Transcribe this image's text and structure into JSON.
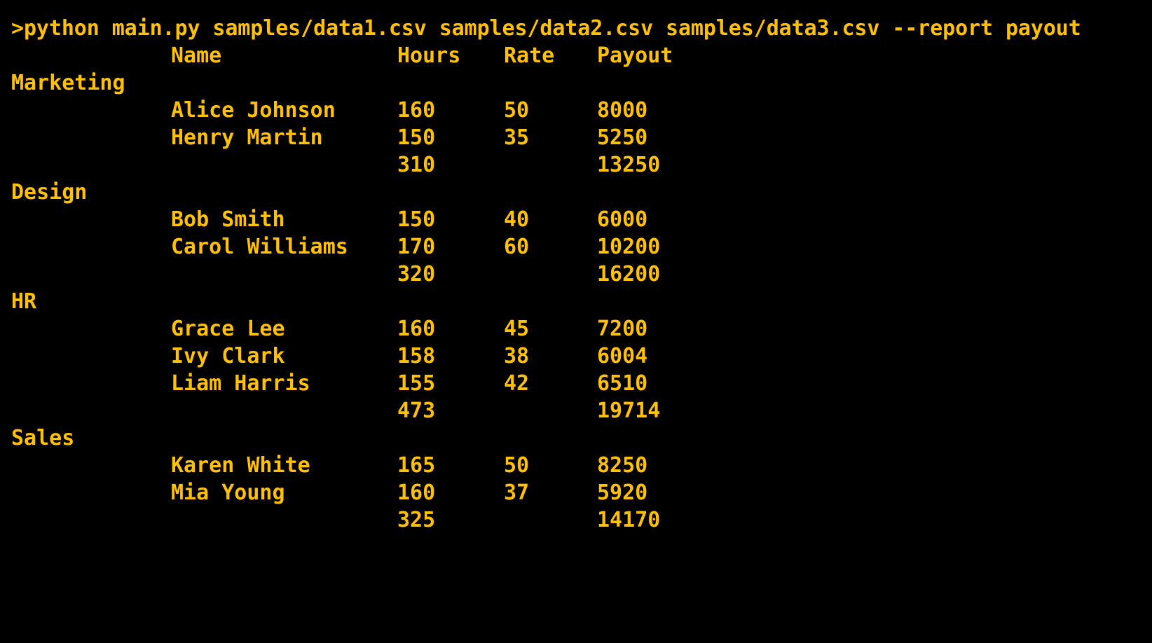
{
  "terminal": {
    "command": ">python main.py samples/data1.csv samples/data2.csv samples/data3.csv --report payout",
    "text_color": "#ffc107",
    "background_color": "#000000"
  },
  "report": {
    "headers": {
      "name": "Name",
      "hours": "Hours",
      "rate": "Rate",
      "payout": "Payout"
    },
    "departments": [
      {
        "name": "Marketing",
        "rows": [
          {
            "name": "Alice Johnson",
            "hours": "160",
            "rate": "50",
            "payout": "8000"
          },
          {
            "name": "Henry Martin",
            "hours": "150",
            "rate": "35",
            "payout": "5250"
          }
        ],
        "total": {
          "hours": "310",
          "payout": "13250"
        }
      },
      {
        "name": "Design",
        "rows": [
          {
            "name": "Bob Smith",
            "hours": "150",
            "rate": "40",
            "payout": "6000"
          },
          {
            "name": "Carol Williams",
            "hours": "170",
            "rate": "60",
            "payout": "10200"
          }
        ],
        "total": {
          "hours": "320",
          "payout": "16200"
        }
      },
      {
        "name": "HR",
        "rows": [
          {
            "name": "Grace Lee",
            "hours": "160",
            "rate": "45",
            "payout": "7200"
          },
          {
            "name": "Ivy Clark",
            "hours": "158",
            "rate": "38",
            "payout": "6004"
          },
          {
            "name": "Liam Harris",
            "hours": "155",
            "rate": "42",
            "payout": "6510"
          }
        ],
        "total": {
          "hours": "473",
          "payout": "19714"
        }
      },
      {
        "name": "Sales",
        "rows": [
          {
            "name": "Karen White",
            "hours": "165",
            "rate": "50",
            "payout": "8250"
          },
          {
            "name": "Mia Young",
            "hours": "160",
            "rate": "37",
            "payout": "5920"
          }
        ],
        "total": {
          "hours": "325",
          "payout": "14170"
        }
      }
    ]
  }
}
